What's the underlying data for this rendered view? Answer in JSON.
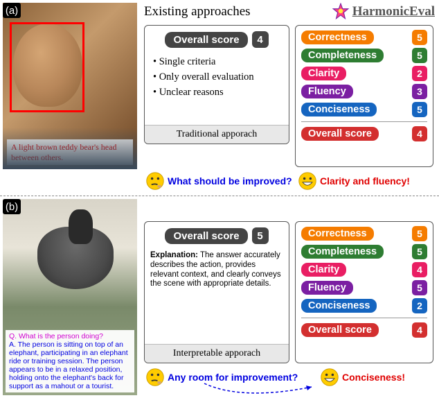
{
  "header": {
    "existing": "Existing approaches",
    "harmonic": "HarmonicEval"
  },
  "panel_a": {
    "tag": "(a)",
    "caption": "A light brown teddy bear's head between others.",
    "traditional": {
      "overall_label": "Overall score",
      "overall_value": "4",
      "bullets": [
        "Single criteria",
        "Only overall evaluation",
        "Unclear reasons"
      ],
      "footer": "Traditional apporach"
    },
    "criteria": [
      {
        "name": "Correctness",
        "value": "5",
        "cls": "c-correct"
      },
      {
        "name": "Completeness",
        "value": "5",
        "cls": "c-complete"
      },
      {
        "name": "Clarity",
        "value": "2",
        "cls": "c-clarity"
      },
      {
        "name": "Fluency",
        "value": "3",
        "cls": "c-fluency"
      },
      {
        "name": "Conciseness",
        "value": "5",
        "cls": "c-concise"
      }
    ],
    "overall": {
      "name": "Overall score",
      "value": "4",
      "cls": "c-overall"
    },
    "question": "What should be improved?",
    "answer": "Clarity and fluency!"
  },
  "panel_b": {
    "tag": "(b)",
    "qa_q": "Q. What is the person doing?",
    "qa_a": "A. The person is sitting on top of an elephant, participating in an elephant ride or training session. The person appears to be in a relaxed position, holding onto the elephant's back for support as a mahout or a tourist.",
    "interpretable": {
      "overall_label": "Overall score",
      "overall_value": "5",
      "explanation_label": "Explanation:",
      "explanation_body": "The answer accurately describes the action, provides relevant context, and clearly conveys the scene with appropriate details.",
      "footer": "Interpretable apporach"
    },
    "criteria": [
      {
        "name": "Correctness",
        "value": "5",
        "cls": "c-correct"
      },
      {
        "name": "Completeness",
        "value": "5",
        "cls": "c-complete"
      },
      {
        "name": "Clarity",
        "value": "4",
        "cls": "c-clarity"
      },
      {
        "name": "Fluency",
        "value": "5",
        "cls": "c-fluency"
      },
      {
        "name": "Conciseness",
        "value": "2",
        "cls": "c-concise"
      }
    ],
    "overall": {
      "name": "Overall score",
      "value": "4",
      "cls": "c-overall"
    },
    "question": "Any room for improvement?",
    "answer": "Conciseness!"
  }
}
